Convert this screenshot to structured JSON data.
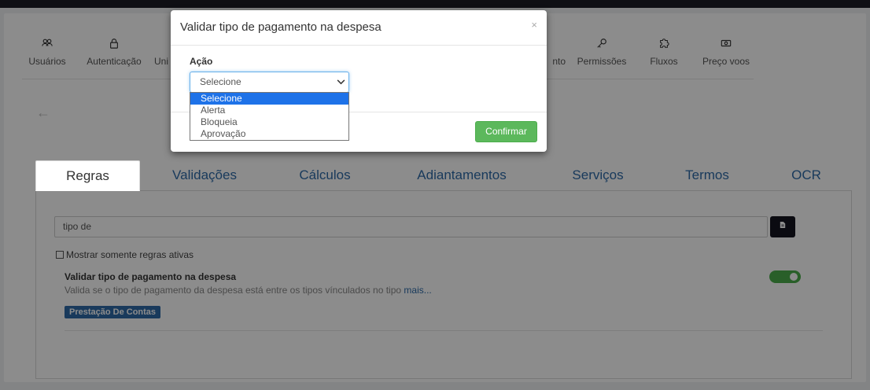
{
  "nav": {
    "items": [
      {
        "label": "Usuários",
        "icon": "users-icon"
      },
      {
        "label": "Autenticação",
        "icon": "lock-icon"
      },
      {
        "label": "Uni",
        "icon": "units-icon"
      },
      {
        "label": "nto",
        "icon": "document-icon"
      },
      {
        "label": "Permissões",
        "icon": "key-icon"
      },
      {
        "label": "Fluxos",
        "icon": "puzzle-icon"
      },
      {
        "label": "Preço voos",
        "icon": "money-icon"
      }
    ]
  },
  "tabs": [
    "Regras",
    "Validações",
    "Cálculos",
    "Adiantamentos",
    "Serviços",
    "Termos",
    "OCR"
  ],
  "search": {
    "value": "tipo de"
  },
  "filter": {
    "label": "Mostrar somente regras ativas"
  },
  "rule": {
    "title": "Validar tipo de pagamento na despesa",
    "description": "Valida se o tipo de pagamento da despesa está entre os tipos vínculados no tipo",
    "more": "mais...",
    "badge": "Prestação De Contas",
    "active": true
  },
  "modal": {
    "title": "Validar tipo de pagamento na despesa",
    "close": "×",
    "field_label": "Ação",
    "select_value": "Selecione",
    "options": [
      "Selecione",
      "Alerta",
      "Bloqueia",
      "Aprovação"
    ],
    "confirm_label": "Confirmar"
  },
  "colors": {
    "accent": "#2e6ba8",
    "success": "#5cb85c",
    "dropdown_highlight": "#1e72e8"
  }
}
